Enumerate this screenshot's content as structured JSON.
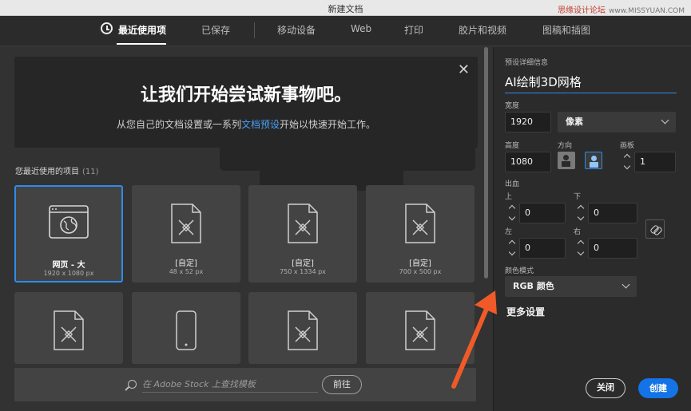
{
  "window": {
    "title": "新建文档",
    "watermark": "思缘设计论坛",
    "watermark_site": "www.MISSYUAN.COM"
  },
  "tabs": [
    {
      "label": "最近使用项",
      "active": true
    },
    {
      "label": "已保存",
      "active": false
    },
    {
      "label": "移动设备",
      "active": false
    },
    {
      "label": "Web",
      "active": false
    },
    {
      "label": "打印",
      "active": false
    },
    {
      "label": "胶片和视频",
      "active": false
    },
    {
      "label": "图稿和插图",
      "active": false
    }
  ],
  "hero": {
    "title": "让我们开始尝试新事物吧。",
    "subtitle_before": "从您自己的文档设置或一系列",
    "subtitle_link": "文档预设",
    "subtitle_after": "开始以快速开始工作。"
  },
  "recent": {
    "label": "您最近使用的项目",
    "count": "(11)",
    "items": [
      {
        "name": "网页 - 大",
        "size": "1920 x 1080 px",
        "icon": "web-globe-icon",
        "selected": true
      },
      {
        "name": "[自定]",
        "size": "48 x 52 px",
        "icon": "custom-document-icon",
        "selected": false
      },
      {
        "name": "[自定]",
        "size": "750 x 1334 px",
        "icon": "custom-document-icon",
        "selected": false
      },
      {
        "name": "[自定]",
        "size": "700 x 500 px",
        "icon": "custom-document-icon",
        "selected": false
      },
      {
        "name": "",
        "size": "",
        "icon": "custom-document-icon",
        "selected": false
      },
      {
        "name": "",
        "size": "",
        "icon": "phone-icon",
        "selected": false
      },
      {
        "name": "",
        "size": "",
        "icon": "custom-document-icon",
        "selected": false
      },
      {
        "name": "",
        "size": "",
        "icon": "custom-document-icon",
        "selected": false
      }
    ]
  },
  "search": {
    "placeholder": "在 Adobe Stock 上查找模板",
    "go_label": "前往"
  },
  "details": {
    "section_label": "预设详细信息",
    "preset_name": "AI绘制3D网格",
    "width_label": "宽度",
    "width_value": "1920",
    "unit": "像素",
    "height_label": "高度",
    "height_value": "1080",
    "orientation_label": "方向",
    "artboards_label": "画板",
    "artboards_value": "1",
    "bleed_label": "出血",
    "bleed_top_label": "上",
    "bleed_top": "0",
    "bleed_bottom_label": "下",
    "bleed_bottom": "0",
    "bleed_left_label": "左",
    "bleed_left": "0",
    "bleed_right_label": "右",
    "bleed_right": "0",
    "color_mode_label": "颜色模式",
    "color_mode": "RGB 颜色",
    "more_settings": "更多设置",
    "close_label": "关闭",
    "create_label": "创建"
  },
  "colors": {
    "accent": "#2d8ceb",
    "create_button": "#1473e6",
    "annotation_arrow": "#f05a28"
  }
}
